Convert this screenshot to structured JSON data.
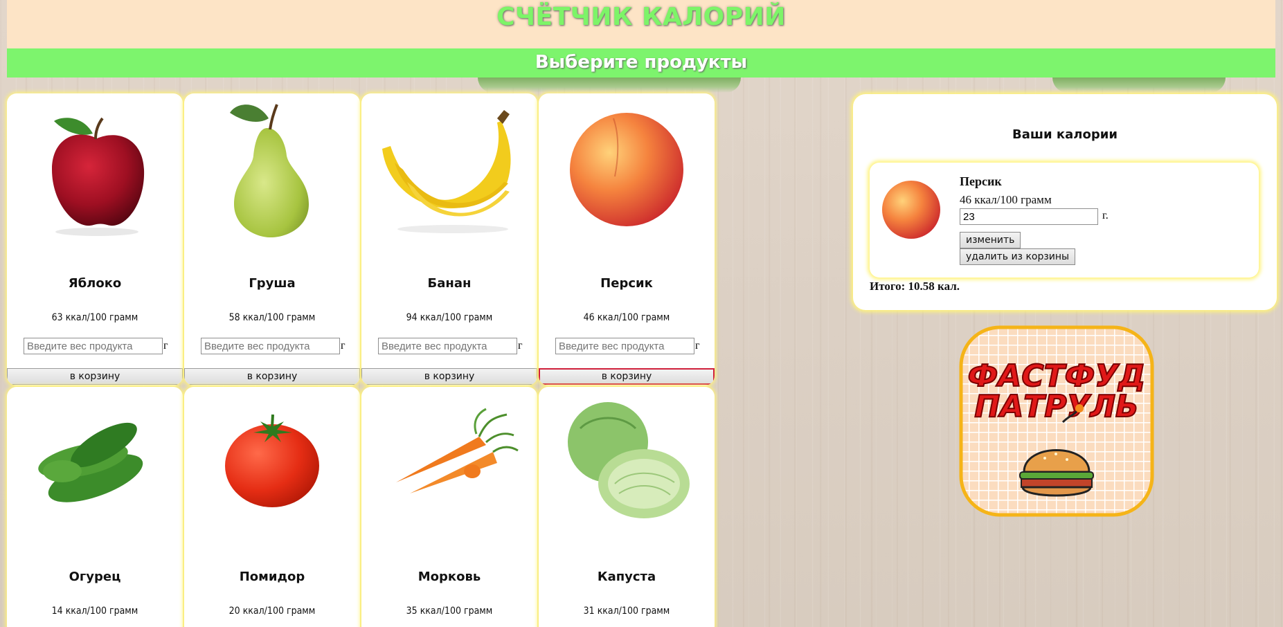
{
  "header": {
    "title": "СЧЁТЧИК КАЛОРИЙ"
  },
  "subheader": {
    "title": "Выберите продукты"
  },
  "products": [
    {
      "name": "Яблоко",
      "kcal": "63 ккал/100 грамм",
      "placeholder": "Введите вес продукта",
      "unit": "г",
      "button": "в корзину"
    },
    {
      "name": "Груша",
      "kcal": "58 ккал/100 грамм",
      "placeholder": "Введите вес продукта",
      "unit": "г",
      "button": "в корзину"
    },
    {
      "name": "Банан",
      "kcal": "94 ккал/100 грамм",
      "placeholder": "Введите вес продукта",
      "unit": "г",
      "button": "в корзину"
    },
    {
      "name": "Персик",
      "kcal": "46 ккал/100 грамм",
      "placeholder": "Введите вес продукта",
      "unit": "г",
      "button": "в корзину"
    },
    {
      "name": "Огурец",
      "kcal": "14 ккал/100 грамм"
    },
    {
      "name": "Помидор",
      "kcal": "20 ккал/100 грамм"
    },
    {
      "name": "Морковь",
      "kcal": "35 ккал/100 грамм"
    },
    {
      "name": "Капуста",
      "kcal": "31 ккал/100 грамм"
    }
  ],
  "sidebar": {
    "title": "Ваши калории",
    "item": {
      "name": "Персик",
      "kcal": "46 ккал/100 грамм",
      "weight_value": "23",
      "unit": "г.",
      "change_button": "изменить",
      "remove_button": "удалить из корзины"
    },
    "total": "Итого: 10.58 кал."
  },
  "badge": {
    "line1": "ФАСТФУД",
    "line2": "ПАТРУЛЬ"
  },
  "colors": {
    "header_bg": "#fde4c6",
    "title_green": "#7df468",
    "subheader_bg": "#7df46d",
    "card_glow": "#fff37a",
    "active_border": "#d0203a"
  }
}
